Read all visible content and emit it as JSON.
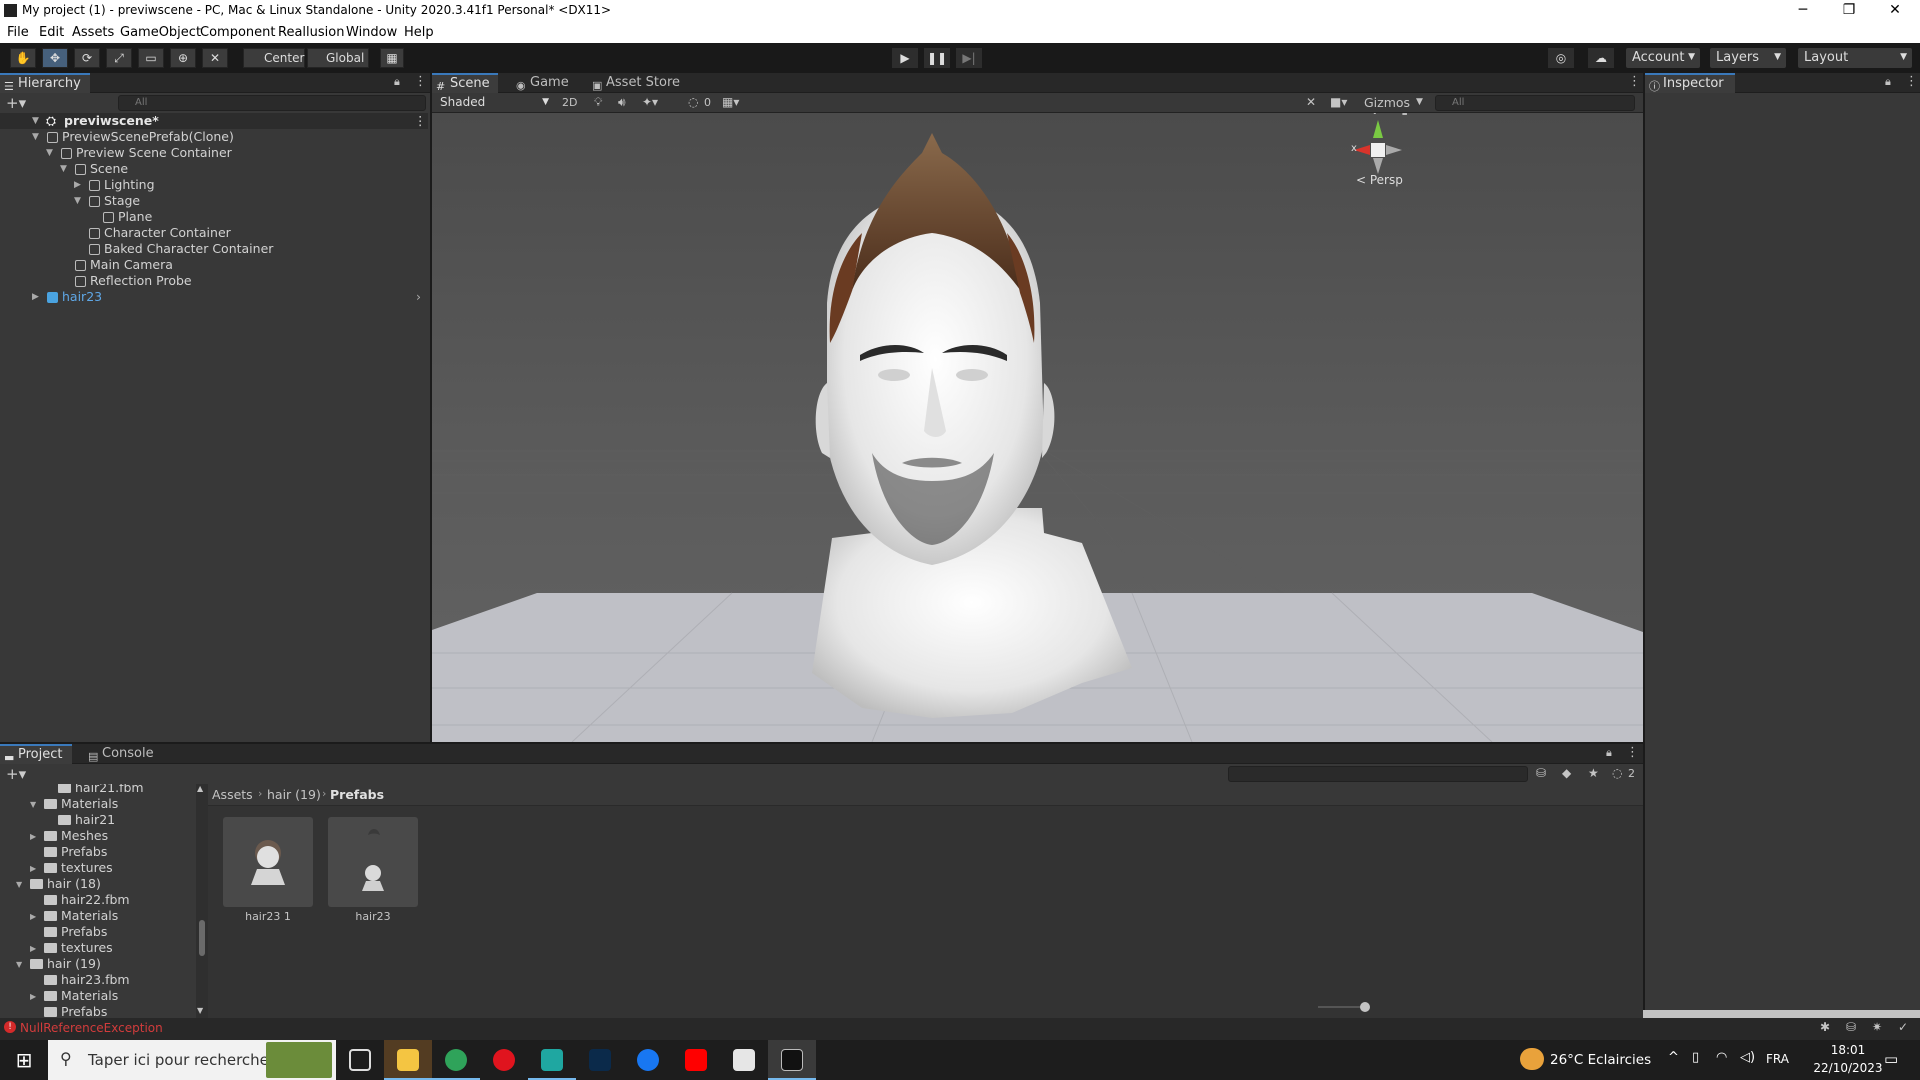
{
  "window": {
    "title": "My project (1) - previwscene - PC, Mac & Linux Standalone - Unity 2020.3.41f1 Personal* <DX11>",
    "min": "─",
    "max": "❐",
    "close": "✕"
  },
  "menu": [
    "File",
    "Edit",
    "Assets",
    "GameObject",
    "Component",
    "Reallusion",
    "Window",
    "Help"
  ],
  "toolbar": {
    "pivot": "Center",
    "space": "Global",
    "account": "Account",
    "layers": "Layers",
    "layout": "Layout"
  },
  "hierarchy": {
    "tab": "Hierarchy",
    "search_placeholder": "All",
    "scene": "previwscene*",
    "rows": [
      {
        "label": "PreviewScenePrefab(Clone)",
        "depth": 1,
        "arrow": "▼"
      },
      {
        "label": "Preview Scene Container",
        "depth": 2,
        "arrow": "▼"
      },
      {
        "label": "Scene",
        "depth": 3,
        "arrow": "▼"
      },
      {
        "label": "Lighting",
        "depth": 4,
        "arrow": "▶"
      },
      {
        "label": "Stage",
        "depth": 4,
        "arrow": "▼"
      },
      {
        "label": "Plane",
        "depth": 5,
        "arrow": ""
      },
      {
        "label": "Character Container",
        "depth": 4,
        "arrow": ""
      },
      {
        "label": "Baked Character Container",
        "depth": 4,
        "arrow": ""
      },
      {
        "label": "Main Camera",
        "depth": 3,
        "arrow": ""
      },
      {
        "label": "Reflection Probe",
        "depth": 3,
        "arrow": ""
      },
      {
        "label": "hair23",
        "depth": 1,
        "arrow": "▶",
        "prefab": true
      }
    ]
  },
  "scene": {
    "tabs": [
      "Scene",
      "Game",
      "Asset Store"
    ],
    "shading": "Shaded",
    "mode2d": "2D",
    "hidden_count": "0",
    "gizmos": "Gizmos",
    "search_placeholder": "All",
    "persp": "< Persp",
    "axis_x": "x",
    "axis_y": "y"
  },
  "inspector": {
    "tab": "Inspector"
  },
  "project": {
    "tabs": [
      "Project",
      "Console"
    ],
    "hidden_count": "2",
    "tree": [
      {
        "label": "hair21.fbm",
        "depth": 2,
        "arrow": ""
      },
      {
        "label": "Materials",
        "depth": 1,
        "arrow": "▼"
      },
      {
        "label": "hair21",
        "depth": 2,
        "arrow": ""
      },
      {
        "label": "Meshes",
        "depth": 1,
        "arrow": "▶"
      },
      {
        "label": "Prefabs",
        "depth": 1,
        "arrow": ""
      },
      {
        "label": "textures",
        "depth": 1,
        "arrow": "▶"
      },
      {
        "label": "hair (18)",
        "depth": 0,
        "arrow": "▼"
      },
      {
        "label": "hair22.fbm",
        "depth": 1,
        "arrow": ""
      },
      {
        "label": "Materials",
        "depth": 1,
        "arrow": "▶"
      },
      {
        "label": "Prefabs",
        "depth": 1,
        "arrow": ""
      },
      {
        "label": "textures",
        "depth": 1,
        "arrow": "▶"
      },
      {
        "label": "hair (19)",
        "depth": 0,
        "arrow": "▼"
      },
      {
        "label": "hair23.fbm",
        "depth": 1,
        "arrow": ""
      },
      {
        "label": "Materials",
        "depth": 1,
        "arrow": "▶"
      },
      {
        "label": "Prefabs",
        "depth": 1,
        "arrow": ""
      }
    ],
    "breadcrumb": [
      "Assets",
      "hair (19)",
      "Prefabs"
    ],
    "assets": [
      {
        "label": "hair23 1"
      },
      {
        "label": "hair23"
      }
    ]
  },
  "status": {
    "error": "NullReferenceException"
  },
  "taskbar": {
    "search_placeholder": "Taper ici pour rechercher",
    "weather": "26°C  Eclaircies",
    "lang": "FRA",
    "time": "18:01",
    "date": "22/10/2023"
  }
}
